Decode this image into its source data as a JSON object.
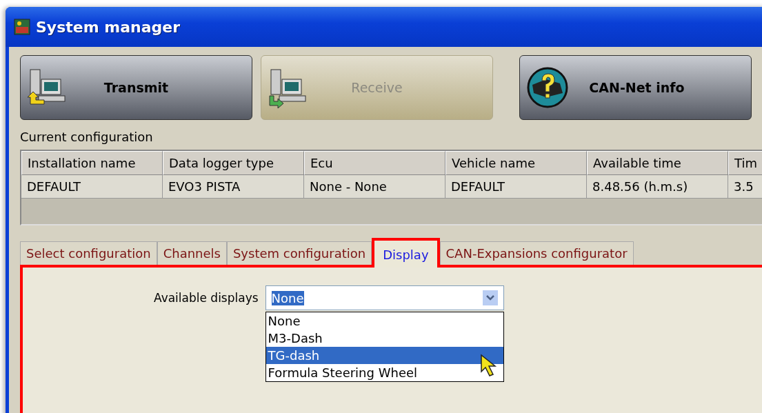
{
  "window": {
    "title": "System manager"
  },
  "toolbar": [
    {
      "label": "Transmit",
      "kind": "transmit",
      "disabled": false
    },
    {
      "label": "Receive",
      "kind": "receive",
      "disabled": true
    },
    {
      "label": "CAN-Net info",
      "kind": "info",
      "disabled": false
    }
  ],
  "current_configuration": {
    "label": "Current configuration",
    "columns": [
      "Installation name",
      "Data logger type",
      "Ecu",
      "Vehicle name",
      "Available time",
      "Tim"
    ],
    "rows": [
      [
        "DEFAULT",
        "EVO3 PISTA",
        "None - None",
        "DEFAULT",
        "8.48.56 (h.m.s)",
        "3.5"
      ]
    ]
  },
  "tabs": [
    {
      "label": "Select configuration",
      "selected": false
    },
    {
      "label": "Channels",
      "selected": false
    },
    {
      "label": "System configuration",
      "selected": false
    },
    {
      "label": "Display",
      "selected": true
    },
    {
      "label": "CAN-Expansions configurator",
      "selected": false
    }
  ],
  "display": {
    "label": "Available displays",
    "value": "None",
    "options": [
      {
        "label": "None",
        "highlighted": false
      },
      {
        "label": "M3-Dash",
        "highlighted": false
      },
      {
        "label": "TG-dash",
        "highlighted": true
      },
      {
        "label": "Formula Steering Wheel",
        "highlighted": false
      }
    ]
  }
}
